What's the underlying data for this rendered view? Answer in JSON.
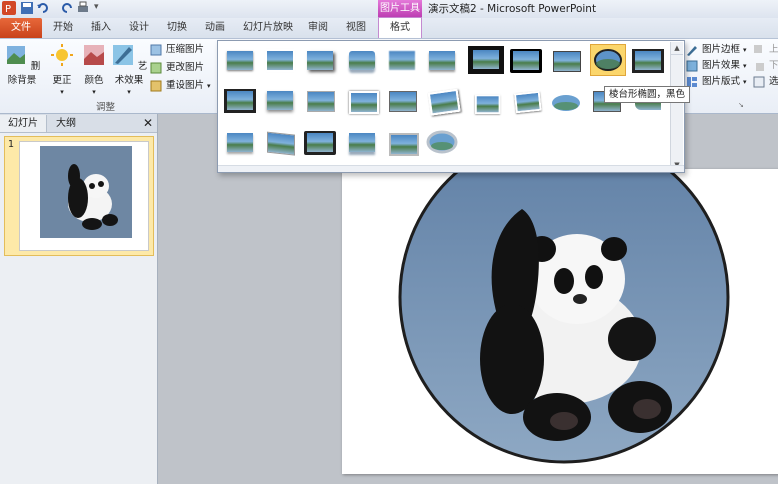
{
  "window": {
    "title": "演示文稿2 - Microsoft PowerPoint",
    "context_tool": "图片工具"
  },
  "tabs": [
    {
      "label": "文件"
    },
    {
      "label": "开始"
    },
    {
      "label": "插入"
    },
    {
      "label": "设计"
    },
    {
      "label": "切换"
    },
    {
      "label": "动画"
    },
    {
      "label": "幻灯片放映"
    },
    {
      "label": "审阅"
    },
    {
      "label": "视图"
    },
    {
      "label": "格式"
    }
  ],
  "ribbon": {
    "adjust": {
      "remove_bg": "删除背景",
      "corrections": "更正",
      "color": "颜色",
      "artistic": "艺术效果",
      "compress": "压缩图片",
      "change": "更改图片",
      "reset": "重设图片",
      "group_label": "调整"
    },
    "right": {
      "border": "图片边框",
      "effects": "图片效果",
      "layout": "图片版式",
      "cut1": "上",
      "cut2": "下",
      "cut3": "选"
    }
  },
  "gallery": {
    "tooltip": "棱台形椭圆，黑色",
    "selected_index": 9
  },
  "panel": {
    "tab_slides": "幻灯片",
    "tab_outline": "大纲",
    "slide_number": "1"
  },
  "colors": {
    "file_tab": "#d4512a",
    "context_tab": "#c34bb7",
    "slide_bg": "#ffffff"
  }
}
